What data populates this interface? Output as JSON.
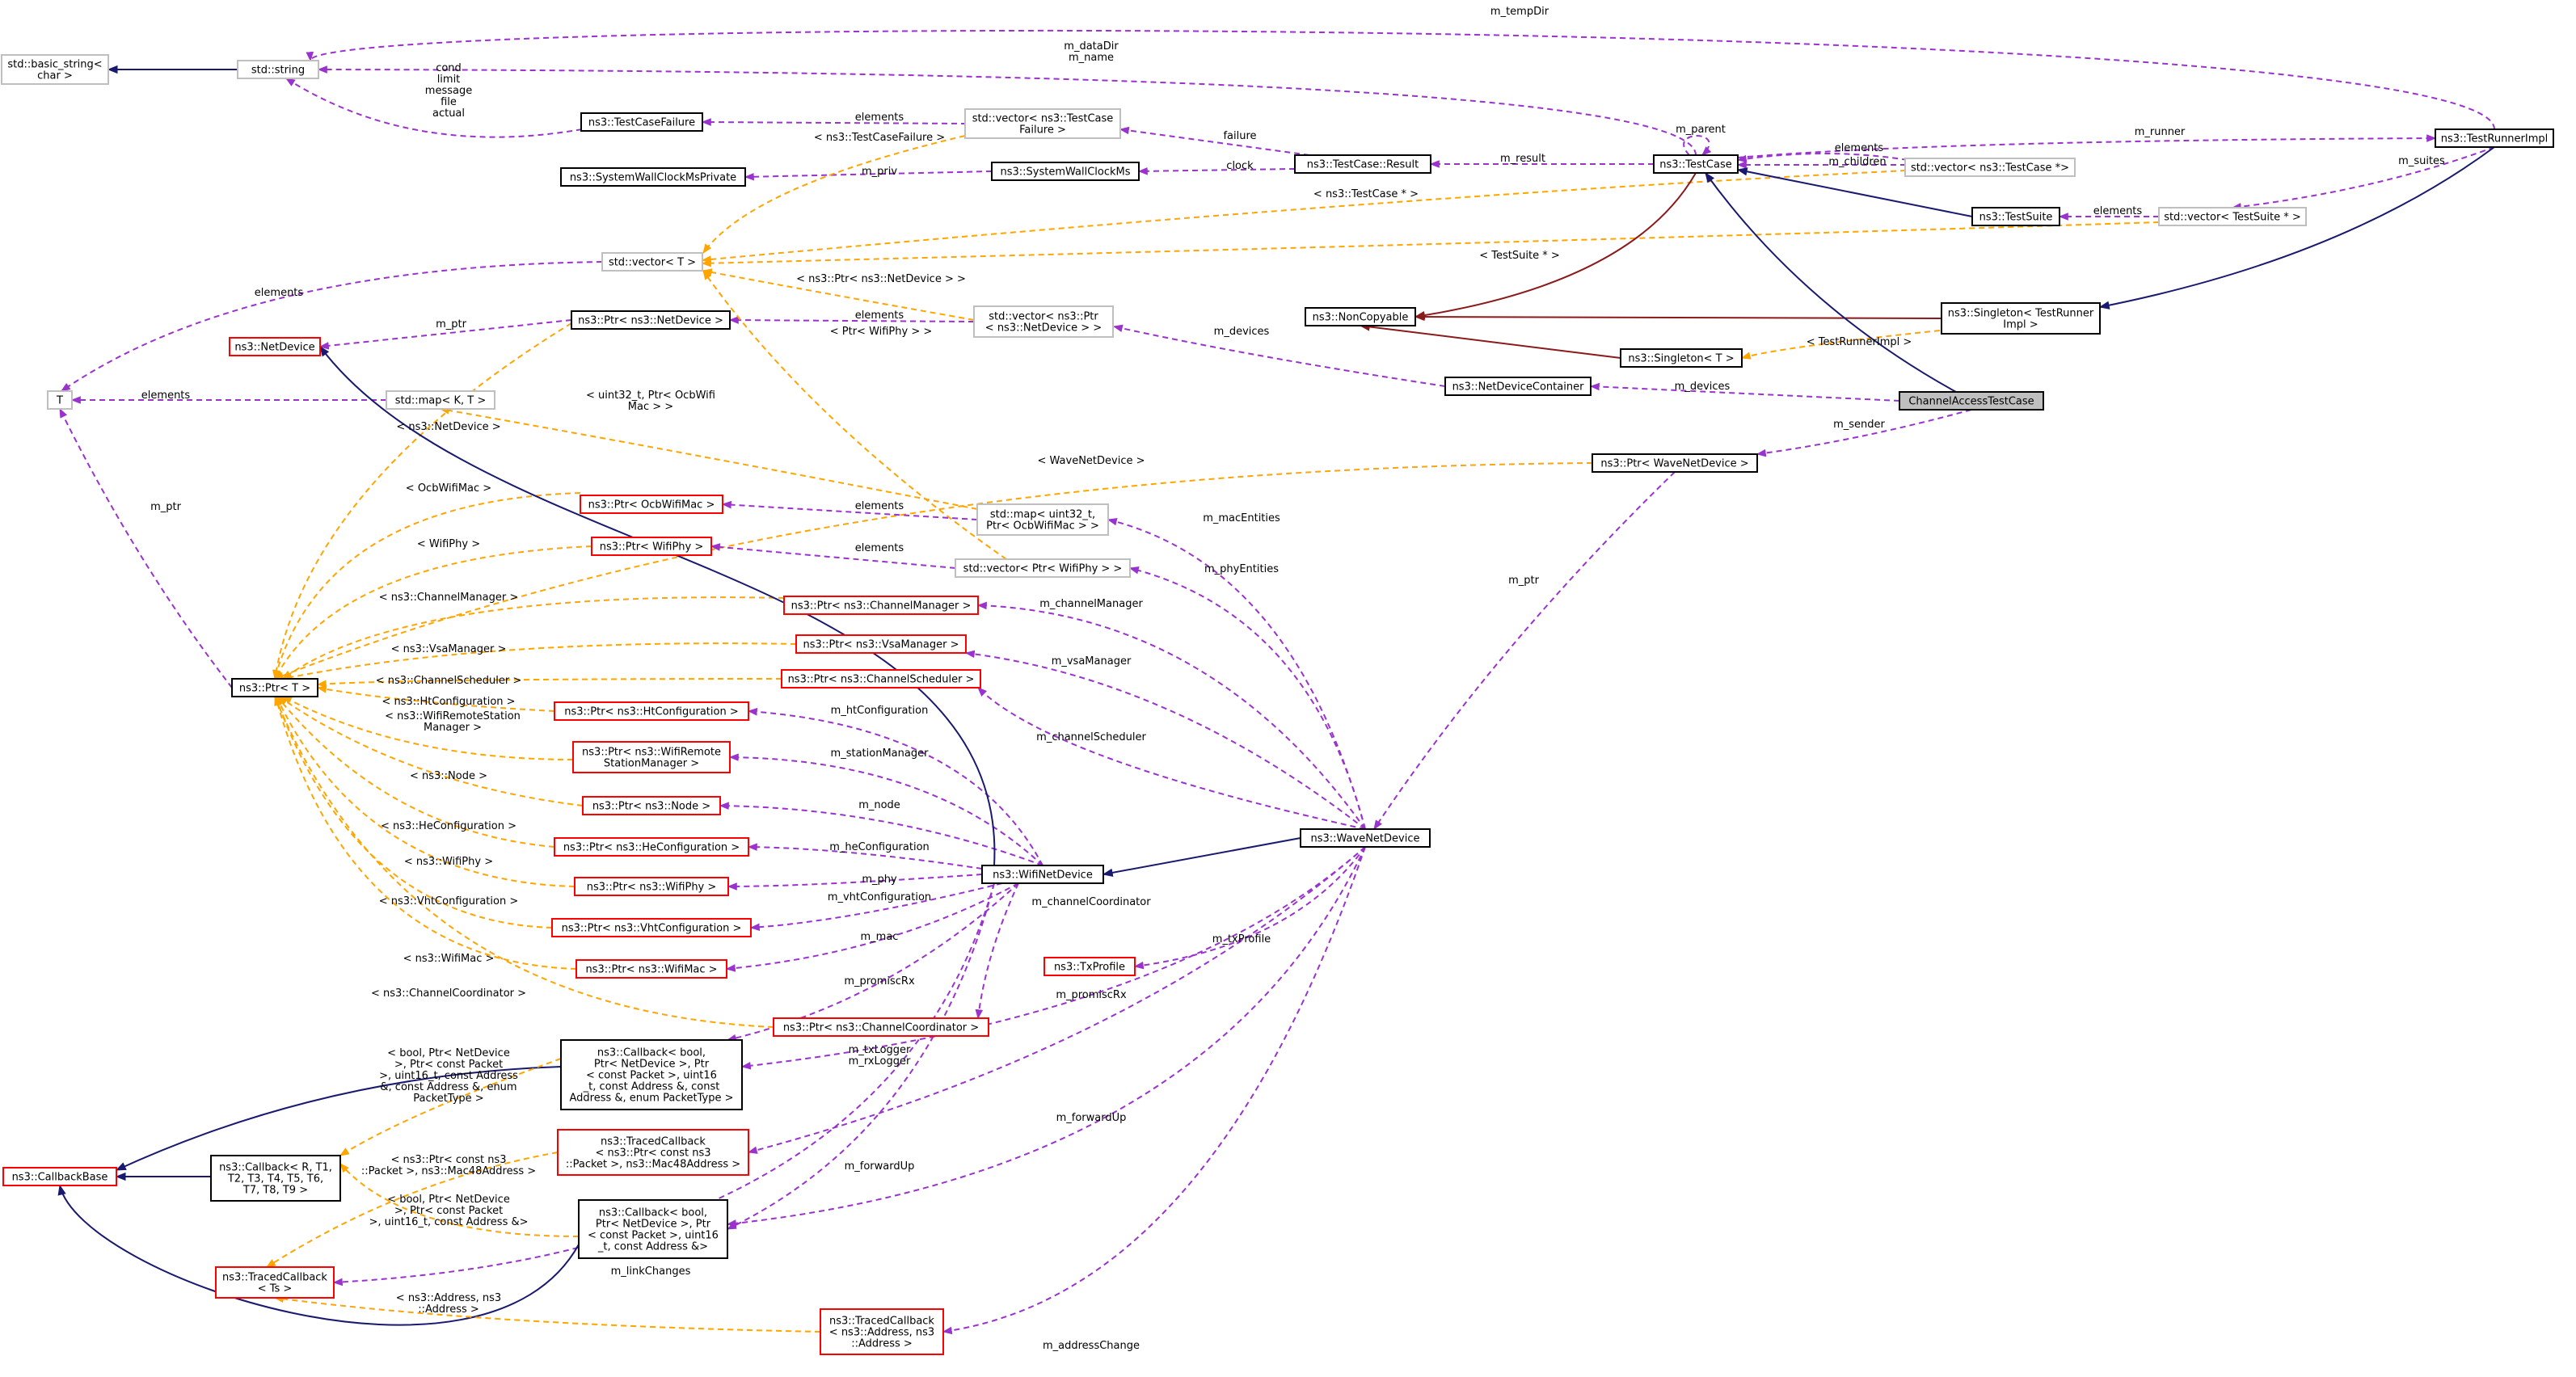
{
  "colors": {
    "black_border": "#000000",
    "gray_border": "#bfbfbf",
    "red_border": "#ff0000",
    "highlight_fill": "#bfbfbf",
    "purple_dashed": "#9a32cd",
    "orange_dashed": "#ffa500",
    "navy_inherit": "#191970",
    "darkred_inherit": "#8b1a1a"
  },
  "nodes": {
    "basic_string": [
      "std::basic_string<",
      "char >"
    ],
    "string": [
      "std::string"
    ],
    "testcasefailure": [
      "ns3::TestCaseFailure"
    ],
    "systemwallclockmsprivate": [
      "ns3::SystemWallClockMsPrivate"
    ],
    "vec_testcasefailure": [
      "std::vector< ns3::TestCase",
      "Failure >"
    ],
    "systemwallclockms": [
      "ns3::SystemWallClockMs"
    ],
    "testcase_result": [
      "ns3::TestCase::Result"
    ],
    "testcase": [
      "ns3::TestCase"
    ],
    "vec_testcase_ptr": [
      "std::vector< ns3::TestCase *>"
    ],
    "testrunnerimpl": [
      "ns3::TestRunnerImpl"
    ],
    "testsuite": [
      "ns3::TestSuite"
    ],
    "vec_testsuite_ptr": [
      "std::vector< TestSuite * >"
    ],
    "vector_t": [
      "std::vector< T >"
    ],
    "noncopyable": [
      "ns3::NonCopyable"
    ],
    "singleton_testrunnerimpl": [
      "ns3::Singleton< TestRunner",
      "Impl >"
    ],
    "singleton_t": [
      "ns3::Singleton< T >"
    ],
    "netdevicecontainer": [
      "ns3::NetDeviceContainer"
    ],
    "channelaccesstestcase": [
      "ChannelAccessTestCase"
    ],
    "ptr_netdevice": [
      "ns3::Ptr< ns3::NetDevice >"
    ],
    "vec_ptr_netdevice": [
      "std::vector< ns3::Ptr",
      "< ns3::NetDevice > >"
    ],
    "netdevice": [
      "ns3::NetDevice"
    ],
    "t": [
      "T"
    ],
    "map_kt": [
      "std::map< K, T >"
    ],
    "ptr_wavenetdevice": [
      "ns3::Ptr< WaveNetDevice >"
    ],
    "ptr_ocbwifimac": [
      "ns3::Ptr< OcbWifiMac >"
    ],
    "map_uint32_ocbwifimac": [
      "std::map< uint32_t,",
      "Ptr< OcbWifiMac > >"
    ],
    "ptr_wifiphy_plain": [
      "ns3::Ptr< WifiPhy >"
    ],
    "vec_ptr_wifiphy": [
      "std::vector< Ptr< WifiPhy > >"
    ],
    "ptr_channelmanager": [
      "ns3::Ptr< ns3::ChannelManager >"
    ],
    "ptr_vsamanager": [
      "ns3::Ptr< ns3::VsaManager >"
    ],
    "ptr_t": [
      "ns3::Ptr< T >"
    ],
    "ptr_channelscheduler": [
      "ns3::Ptr< ns3::ChannelScheduler >"
    ],
    "ptr_htconfiguration": [
      "ns3::Ptr< ns3::HtConfiguration >"
    ],
    "ptr_wifiremotestationmanager": [
      "ns3::Ptr< ns3::WifiRemote",
      "StationManager >"
    ],
    "ptr_node": [
      "ns3::Ptr< ns3::Node >"
    ],
    "wavenetdevice": [
      "ns3::WaveNetDevice"
    ],
    "ptr_heconfiguration": [
      "ns3::Ptr< ns3::HeConfiguration >"
    ],
    "wifinetdevice": [
      "ns3::WifiNetDevice"
    ],
    "ptr_wifiphy": [
      "ns3::Ptr< ns3::WifiPhy >"
    ],
    "ptr_vhtconfiguration": [
      "ns3::Ptr< ns3::VhtConfiguration >"
    ],
    "txprofile": [
      "ns3::TxProfile"
    ],
    "ptr_wifimac": [
      "ns3::Ptr< ns3::WifiMac >"
    ],
    "ptr_channelcoordinator": [
      "ns3::Ptr< ns3::ChannelCoordinator >"
    ],
    "callback_promisc": [
      "ns3::Callback< bool,",
      "Ptr< NetDevice >, Ptr",
      "< const Packet >, uint16",
      "_t, const Address &, const",
      "Address &, enum PacketType >"
    ],
    "callbackbase": [
      "ns3::CallbackBase"
    ],
    "callback_rt": [
      "ns3::Callback< R, T1,",
      "T2, T3, T4, T5, T6,",
      "T7, T8, T9 >"
    ],
    "tracedcallback_packet_mac48": [
      "ns3::TracedCallback",
      "< ns3::Ptr< const ns3",
      "::Packet >, ns3::Mac48Address >"
    ],
    "callback_forwardup": [
      "ns3::Callback< bool,",
      "Ptr< NetDevice >, Ptr",
      "< const Packet >, uint16",
      "_t, const Address &>"
    ],
    "tracedcallback_ts": [
      "ns3::TracedCallback",
      "< Ts >"
    ],
    "tracedcallback_address": [
      "ns3::TracedCallback",
      "< ns3::Address, ns3",
      "::Address >"
    ]
  },
  "edge_labels": {
    "m_tempdir": [
      "m_tempDir"
    ],
    "m_datadir": [
      "m_dataDir",
      "m_name"
    ],
    "cond": [
      "cond",
      "limit",
      "message",
      "file",
      "actual"
    ],
    "elements_tcf": [
      "elements"
    ],
    "failure": [
      "failure"
    ],
    "m_parent": [
      "m_parent"
    ],
    "elements_tc": [
      "elements"
    ],
    "m_children": [
      "m_children"
    ],
    "m_runner": [
      "m_runner"
    ],
    "m_priv": [
      "m_priv"
    ],
    "clock": [
      "clock"
    ],
    "m_result": [
      "m_result"
    ],
    "m_suites": [
      "m_suites"
    ],
    "tpl_tcfailure": [
      "< ns3::TestCaseFailure >"
    ],
    "tpl_testcase_ptr": [
      "< ns3::TestCase * >"
    ],
    "elements_ts": [
      "elements"
    ],
    "tpl_testsuite_ptr": [
      "< TestSuite * >"
    ],
    "elements_t": [
      "elements"
    ],
    "tpl_ptr_netdevice": [
      "< ns3::Ptr< ns3::NetDevice > >"
    ],
    "m_ptr_nd": [
      "m_ptr"
    ],
    "elements_pnd": [
      "elements"
    ],
    "tpl_ptr_wifiphy": [
      "< Ptr< WifiPhy > >"
    ],
    "m_devices_vec": [
      "m_devices"
    ],
    "tpl_testrunnerimpl": [
      "< TestRunnerImpl >"
    ],
    "m_devices_ctr": [
      "m_devices"
    ],
    "elements_map": [
      "elements"
    ],
    "tpl_uint32_ocb": [
      "< uint32_t, Ptr< OcbWifi",
      "Mac > >"
    ],
    "m_sender": [
      "m_sender"
    ],
    "tpl_netdevice": [
      "< ns3::NetDevice >"
    ],
    "tpl_wavenetdevice": [
      "< WaveNetDevice >"
    ],
    "tpl_ocbwifimac": [
      "< OcbWifiMac >"
    ],
    "elements_ocb": [
      "elements"
    ],
    "m_macentities": [
      "m_macEntities"
    ],
    "m_ptr_t": [
      "m_ptr"
    ],
    "tpl_wifiphy_plain": [
      "< WifiPhy >"
    ],
    "elements_phy": [
      "elements"
    ],
    "m_phyentities": [
      "m_phyEntities"
    ],
    "m_ptr_wave": [
      "m_ptr"
    ],
    "tpl_channelmanager": [
      "< ns3::ChannelManager >"
    ],
    "m_channelmanager": [
      "m_channelManager"
    ],
    "tpl_vsamanager": [
      "< ns3::VsaManager >"
    ],
    "m_vsamanager": [
      "m_vsaManager"
    ],
    "tpl_channelscheduler": [
      "< ns3::ChannelScheduler >"
    ],
    "tpl_htconfiguration": [
      "< ns3::HtConfiguration >"
    ],
    "m_htconfiguration": [
      "m_htConfiguration"
    ],
    "m_channelscheduler": [
      "m_channelScheduler"
    ],
    "tpl_wifiremotestation": [
      "< ns3::WifiRemoteStation",
      "Manager >"
    ],
    "m_stationmanager": [
      "m_stationManager"
    ],
    "tpl_node": [
      "< ns3::Node >"
    ],
    "m_node": [
      "m_node"
    ],
    "tpl_heconfiguration": [
      "< ns3::HeConfiguration >"
    ],
    "m_heconfiguration": [
      "m_heConfiguration"
    ],
    "tpl_wifiphy": [
      "< ns3::WifiPhy >"
    ],
    "m_phy": [
      "m_phy"
    ],
    "m_vhtconfiguration": [
      "m_vhtConfiguration"
    ],
    "m_channelcoordinator": [
      "m_channelCoordinator"
    ],
    "tpl_vhtconfiguration": [
      "< ns3::VhtConfiguration >"
    ],
    "m_txprofile": [
      "m_txProfile"
    ],
    "m_mac": [
      "m_mac"
    ],
    "tpl_wifimac": [
      "< ns3::WifiMac >"
    ],
    "m_promiscrx_wifi": [
      "m_promiscRx"
    ],
    "m_promiscrx_wave": [
      "m_promiscRx"
    ],
    "tpl_channelcoordinator": [
      "< ns3::ChannelCoordinator >"
    ],
    "m_txlogger": [
      "m_txLogger",
      "m_rxLogger"
    ],
    "tpl_bool_ptr_netdevice_promisc": [
      "< bool, Ptr< NetDevice",
      ">, Ptr< const Packet",
      ">, uint16_t, const Address",
      "&, const Address &, enum",
      "PacketType >"
    ],
    "m_forwardup_wave": [
      "m_forwardUp"
    ],
    "tpl_ptr_packet_mac48": [
      "< ns3::Ptr< const ns3",
      "::Packet >, ns3::Mac48Address >"
    ],
    "m_forwardup_wifi": [
      "m_forwardUp"
    ],
    "tpl_bool_ptr_netdevice_fwd": [
      "< bool, Ptr< NetDevice",
      ">, Ptr< const Packet",
      ">, uint16_t, const Address &>"
    ],
    "m_linkchanges": [
      "m_linkChanges"
    ],
    "tpl_address": [
      "< ns3::Address, ns3",
      "::Address >"
    ],
    "m_addresschange": [
      "m_addressChange"
    ]
  }
}
